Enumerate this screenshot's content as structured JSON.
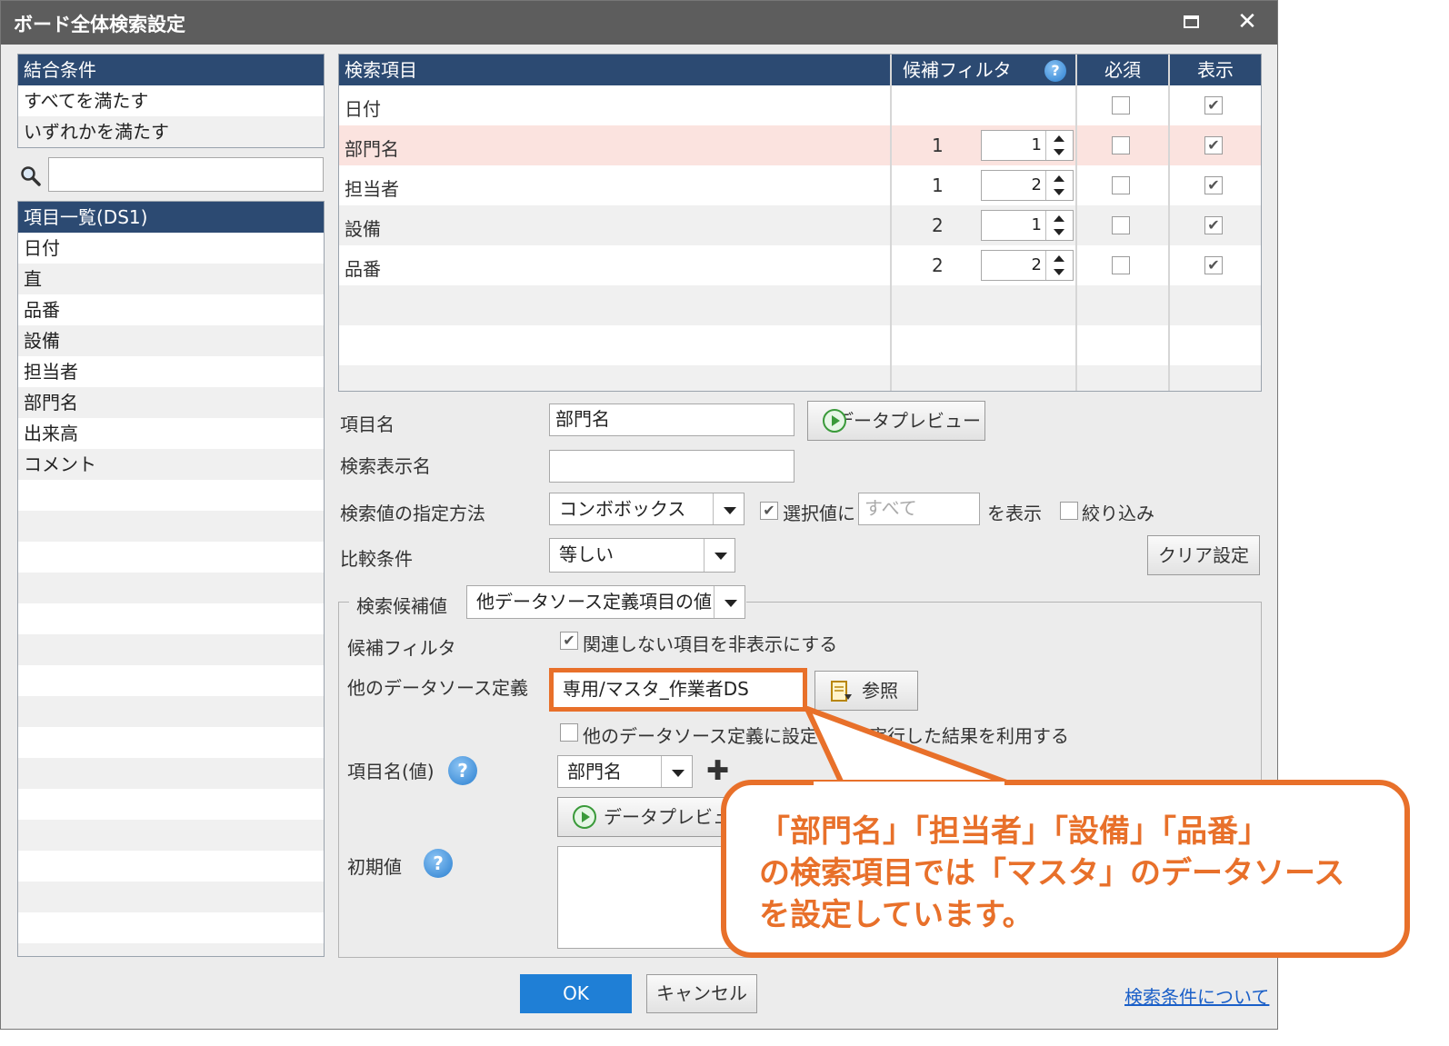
{
  "window": {
    "title": "ボード全体検索設定"
  },
  "combine": {
    "header": "結合条件",
    "options": [
      "すべてを満たす",
      "いずれかを満たす"
    ]
  },
  "items_list": {
    "header": "項目一覧(DS1)",
    "items": [
      "日付",
      "直",
      "品番",
      "設備",
      "担当者",
      "部門名",
      "出来高",
      "コメント"
    ]
  },
  "grid": {
    "columns": {
      "item": "検索項目",
      "filter": "候補フィルタ",
      "required": "必須",
      "display": "表示"
    },
    "rows": [
      {
        "name": "日付",
        "filter": "",
        "spin": "",
        "required": false,
        "display": true
      },
      {
        "name": "部門名",
        "filter": "1",
        "spin": "1",
        "required": false,
        "display": true
      },
      {
        "name": "担当者",
        "filter": "1",
        "spin": "2",
        "required": false,
        "display": true
      },
      {
        "name": "設備",
        "filter": "2",
        "spin": "1",
        "required": false,
        "display": true
      },
      {
        "name": "品番",
        "filter": "2",
        "spin": "2",
        "required": false,
        "display": true
      }
    ]
  },
  "form": {
    "item_name_label": "項目名",
    "item_name_value": "部門名",
    "data_preview_label": "データプレビュー",
    "display_name_label": "検索表示名",
    "display_name_value": "",
    "method_label": "検索値の指定方法",
    "method_value": "コンボボックス",
    "selected_label": "選択値に",
    "selected_input_placeholder": "すべて",
    "show_label": "を表示",
    "narrow_label": "絞り込み",
    "compare_label": "比較条件",
    "compare_value": "等しい",
    "clear_label": "クリア設定",
    "candidate_label": "検索候補値",
    "candidate_value": "他データソース定義項目の値",
    "candidate_filter_label": "候補フィルタ",
    "hide_unrelated_label": "関連しない項目を非表示にする",
    "other_ds_label": "他のデータソース定義",
    "other_ds_value": "専用/マスタ_作業者DS",
    "browse_label": "参照",
    "use_result_label_a": "他のデータソース定義に設定さ",
    "use_result_label_b": "実行した結果を利用する",
    "value_item_label": "項目名(値)",
    "value_item_value": "部門名",
    "data_preview2_label": "データプレビュー",
    "initial_label": "初期値"
  },
  "footer": {
    "ok": "OK",
    "cancel": "キャンセル",
    "help_link": "検索条件について"
  },
  "callout": {
    "line1": "「部門名」「担当者」「設備」「品番」",
    "line2": "の検索項目では「マスタ」のデータソース",
    "line3": "を設定しています。"
  },
  "colors": {
    "header": "#2c4a72",
    "accent": "#e8702a",
    "ok": "#1f7fd6",
    "selected_row": "#fbe3df"
  }
}
